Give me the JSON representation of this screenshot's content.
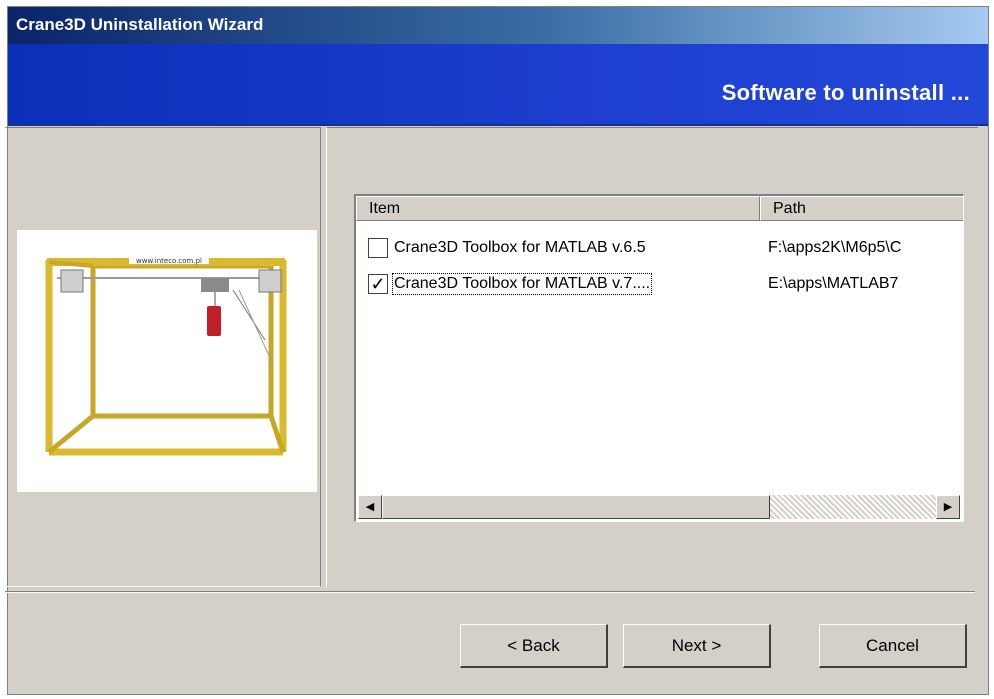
{
  "window": {
    "title": "Crane3D Uninstallation Wizard"
  },
  "banner": {
    "heading": "Software to uninstall ..."
  },
  "illustration": {
    "caption": "www.inteco.com.pl"
  },
  "list": {
    "columns": [
      "Item",
      "Path"
    ],
    "rows": [
      {
        "checked": false,
        "item": "Crane3D Toolbox for MATLAB v.6.5",
        "path": "F:\\apps2K\\M6p5\\C"
      },
      {
        "checked": true,
        "item": "Crane3D Toolbox for MATLAB v.7....",
        "path": "E:\\apps\\MATLAB7"
      }
    ]
  },
  "scrollbar": {
    "left_arrow": "◀",
    "right_arrow": "▶"
  },
  "buttons": {
    "back": "< Back",
    "next": "Next >",
    "cancel": "Cancel"
  },
  "colors": {
    "title_start": "#0a246a",
    "banner": "#1e3fcf",
    "face": "#d4d0c8",
    "frame_yellow": "#d9b92e"
  }
}
